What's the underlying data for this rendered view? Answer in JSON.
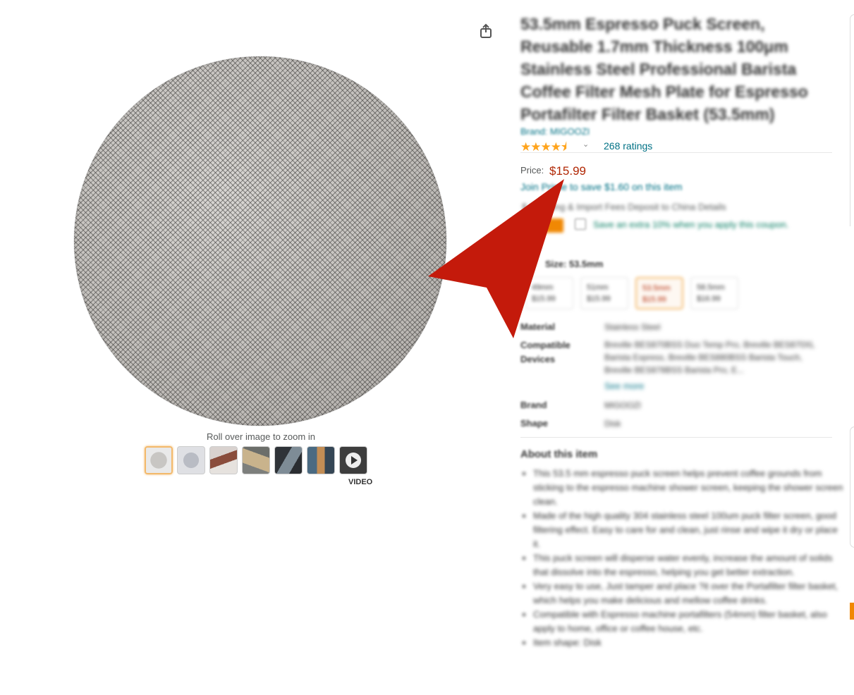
{
  "product": {
    "title": "53.5mm Espresso Puck Screen, Reusable 1.7mm Thickness 100μm Stainless Steel Professional Barista Coffee Filter Mesh Plate for Espresso Portafilter Filter Basket (53.5mm)",
    "brand_line": "Brand: MIGOOZI",
    "stars": "★★★★⯨",
    "ratings": "268 ratings",
    "price_label": "Price:",
    "price": "$15.99",
    "prime_line": "Join Prime to save $1.60 on this item",
    "shipping": "$ Shipping & Import Fees Deposit to China Details",
    "coupon_text": "Save an extra 10% when you apply this coupon.",
    "size_label": "Size: 53.5mm"
  },
  "gallery": {
    "zoom_hint": "Roll over image to zoom in",
    "video_label": "VIDEO"
  },
  "sizes": [
    {
      "name": "49mm",
      "price": "$15.99"
    },
    {
      "name": "51mm",
      "price": "$15.99"
    },
    {
      "name": "53.5mm",
      "price": "$15.99"
    },
    {
      "name": "58.5mm",
      "price": "$16.99"
    }
  ],
  "specs": {
    "material_k": "Material",
    "material_v": "Stainless Steel",
    "devices_k": "Compatible Devices",
    "devices_v": "Breville BES870BSS Duo Temp Pro, Breville BES870XL Barista Express, Breville BES880BSS Barista Touch, Breville BES878BSS Barista Pro, E...",
    "see_more": "See more",
    "brand_k": "Brand",
    "brand_v": "MIGOOZI",
    "shape_k": "Shape",
    "shape_v": "Disk"
  },
  "about": {
    "title": "About this item",
    "bullets": [
      "This 53.5 mm espresso puck screen helps prevent coffee grounds from sticking to the espresso machine shower screen, keeping the shower screen clean.",
      "Made of the high quality 304 stainless steel 100um puck filter screen, good filtering effect. Easy to care for and clean, just rinse and wipe it dry or place it.",
      "This puck screen will disperse water evenly, increase the amount of solids that dissolve into the espresso, helping you get better extraction.",
      "Very easy to use, Just tamper and place ?it over the Portafilter filter basket, which helps you make delicious and mellow coffee drinks.",
      "Compatible with Espresso machine portafilters (54mm) filter basket, also apply to home, office or coffee house, etc.",
      "Item shape: Disk"
    ]
  },
  "colors": {
    "price": "#B12704",
    "link": "#007185",
    "arrow": "#C41A0B",
    "star": "#FFA41C"
  }
}
